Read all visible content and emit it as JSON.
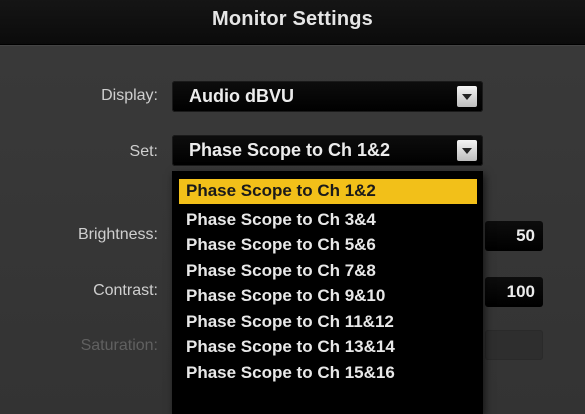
{
  "window": {
    "title": "Monitor Settings"
  },
  "display": {
    "label": "Display:",
    "value": "Audio dBVU"
  },
  "set": {
    "label": "Set:",
    "value": "Phase Scope to Ch 1&2",
    "options": [
      "Phase Scope to Ch 1&2",
      "Phase Scope to Ch 3&4",
      "Phase Scope to Ch 5&6",
      "Phase Scope to Ch 7&8",
      "Phase Scope to Ch 9&10",
      "Phase Scope to Ch 11&12",
      "Phase Scope to Ch 13&14",
      "Phase Scope to Ch 15&16"
    ]
  },
  "brightness": {
    "label": "Brightness:",
    "value": "50"
  },
  "contrast": {
    "label": "Contrast:",
    "value": "100"
  },
  "saturation": {
    "label": "Saturation:",
    "value": ""
  },
  "colors": {
    "highlight": "#f2c019",
    "panel": "#363636",
    "titlebar": "#0f0f0f"
  }
}
